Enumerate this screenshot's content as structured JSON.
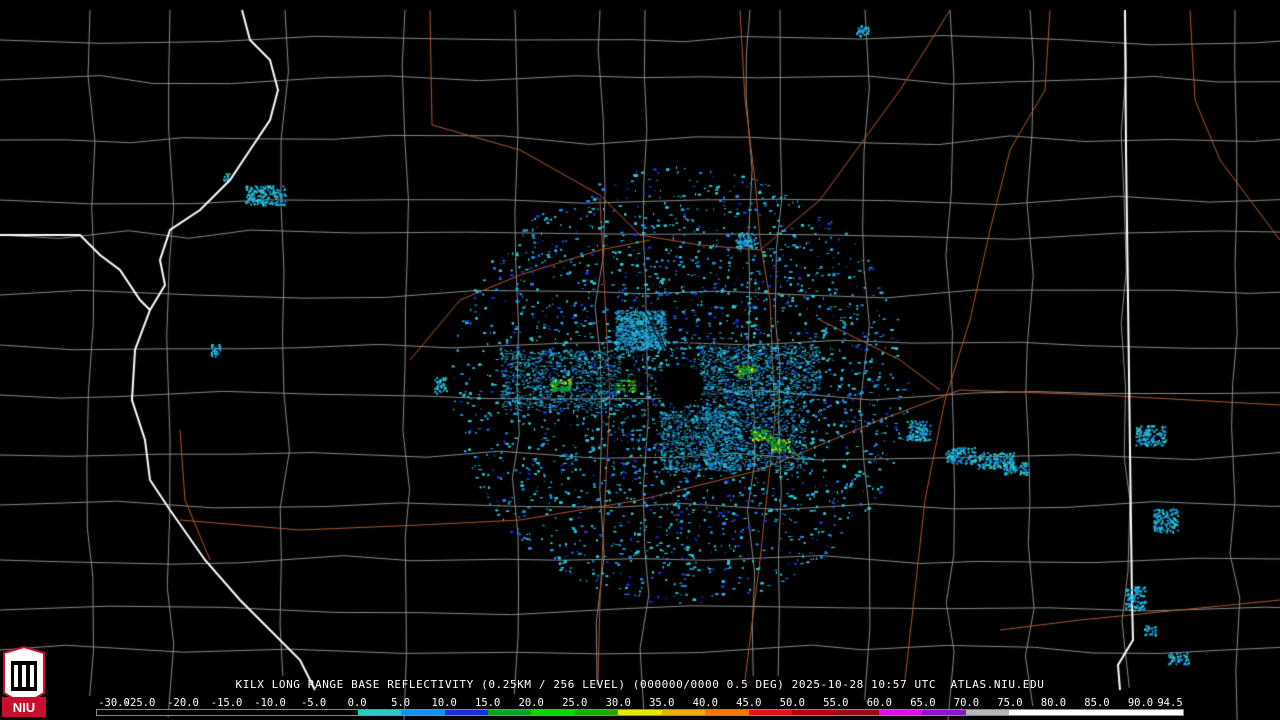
{
  "product": {
    "title": "KILX LONG RANGE BASE REFLECTIVITY (0.25KM / 256 LEVEL) (000000/0000 0.5 DEG) 2025-10-28 10:57 UTC  ATLAS.NIU.EDU"
  },
  "logo": {
    "text": "NIU",
    "color": "#c8102e"
  },
  "scale": {
    "labels": [
      "-30.0",
      "-25.0",
      "-20.0",
      "-15.0",
      "-10.0",
      "-5.0",
      "0.0",
      "5.0",
      "10.0",
      "15.0",
      "20.0",
      "25.0",
      "30.0",
      "35.0",
      "40.0",
      "45.0",
      "50.0",
      "55.0",
      "60.0",
      "65.0",
      "70.0",
      "75.0",
      "80.0",
      "85.0",
      "90.0",
      "94.5"
    ],
    "colors": [
      "#000000",
      "#000000",
      "#000000",
      "#000000",
      "#000000",
      "#000000",
      "#28c8d0",
      "#1890e8",
      "#1830d8",
      "#10a020",
      "#08d808",
      "#20a808",
      "#e8e800",
      "#e8b000",
      "#f07800",
      "#e81010",
      "#b80000",
      "#901010",
      "#e010e0",
      "#8818c8",
      "#b8b8b8",
      "#ffffff",
      "#ffffff",
      "#ffffff",
      "#ffffff"
    ]
  },
  "map": {
    "radar_site": "KILX",
    "state_line_color": "#ffffff",
    "county_line_color": "#8a8a8a",
    "highway_color": "#b0582a"
  }
}
